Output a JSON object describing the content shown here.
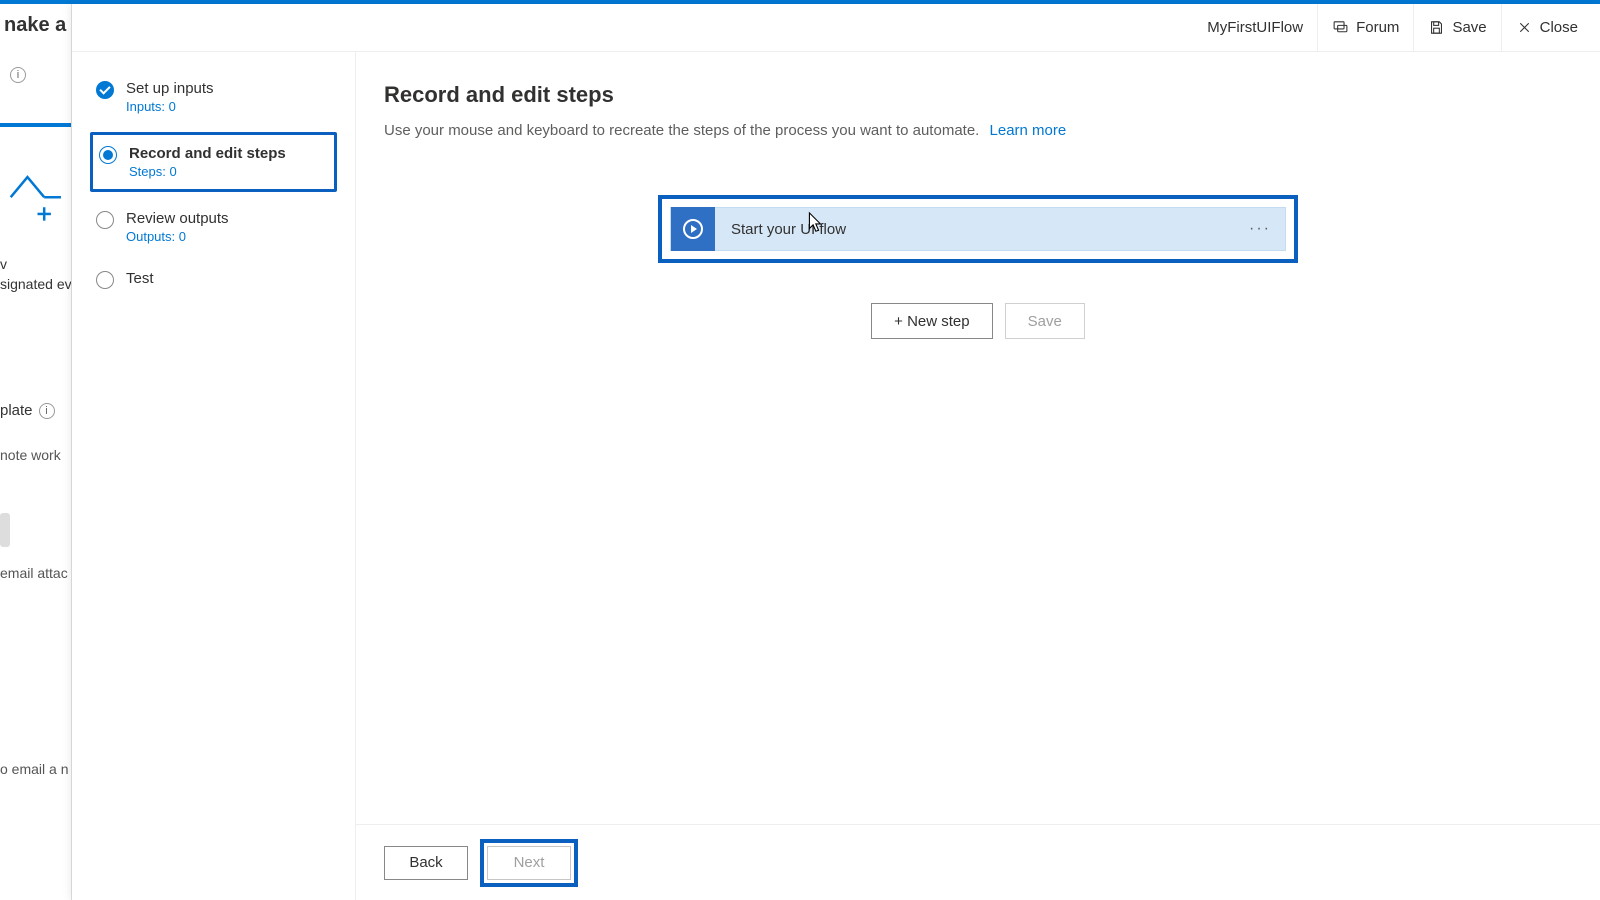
{
  "bg": {
    "title_fragment": "nake a fl",
    "designated_fragment": "signated even",
    "template_fragment": "plate",
    "remote_fragment": "note work",
    "attach_fragment": "email attac",
    "email_fragment": "o email a n"
  },
  "header": {
    "flow_name": "MyFirstUIFlow",
    "forum": "Forum",
    "save": "Save",
    "close": "Close"
  },
  "sidebar": {
    "steps": [
      {
        "title": "Set up inputs",
        "sub": "Inputs: 0",
        "state": "done"
      },
      {
        "title": "Record and edit steps",
        "sub": "Steps: 0",
        "state": "active"
      },
      {
        "title": "Review outputs",
        "sub": "Outputs: 0",
        "state": "pending"
      },
      {
        "title": "Test",
        "sub": "",
        "state": "pending"
      }
    ]
  },
  "main": {
    "heading": "Record and edit steps",
    "description": "Use your mouse and keyboard to recreate the steps of the process you want to automate.",
    "learn_more": "Learn more",
    "card_title": "Start your UI flow",
    "new_step": "+ New step",
    "save": "Save"
  },
  "footer": {
    "back": "Back",
    "next": "Next"
  }
}
